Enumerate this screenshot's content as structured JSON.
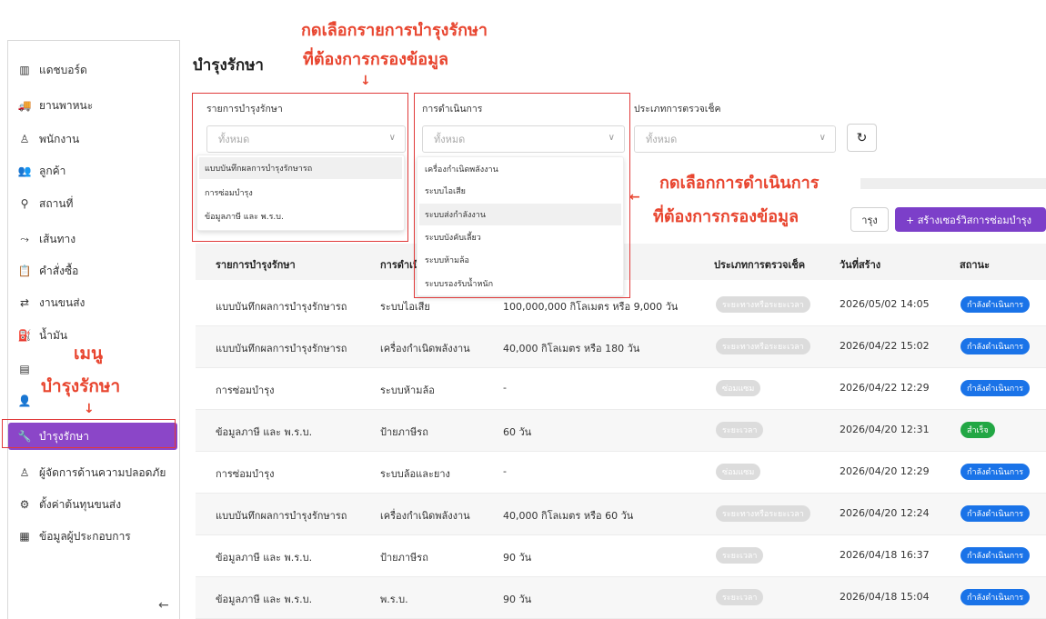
{
  "sidebar": {
    "items": [
      {
        "label": "แดชบอร์ด",
        "icon": "chart-bar-icon",
        "glyph": "▥"
      },
      {
        "label": "ยานพาหนะ",
        "icon": "truck-icon",
        "glyph": "🚚"
      },
      {
        "label": "พนักงาน",
        "icon": "user-icon",
        "glyph": "♙"
      },
      {
        "label": "ลูกค้า",
        "icon": "users-icon",
        "glyph": "👥"
      },
      {
        "label": "สถานที่",
        "icon": "location-pin-icon",
        "glyph": "⚲"
      },
      {
        "label": "เส้นทาง",
        "icon": "route-icon",
        "glyph": "⤳"
      },
      {
        "label": "คำสั่งซื้อ",
        "icon": "clipboard-icon",
        "glyph": "📋"
      },
      {
        "label": "งานขนส่ง",
        "icon": "transport-icon",
        "glyph": "⇄"
      },
      {
        "label": "น้ำมัน",
        "icon": "fuel-icon",
        "glyph": "⛽"
      },
      {
        "label": "",
        "icon": "report-icon",
        "glyph": "▤"
      },
      {
        "label": "",
        "icon": "user-group-icon",
        "glyph": "👤"
      },
      {
        "label": "บำรุงรักษา",
        "icon": "wrench-icon",
        "glyph": "🔧"
      },
      {
        "label": "ผู้จัดการด้านความปลอดภัย",
        "icon": "safety-user-icon",
        "glyph": "♙"
      },
      {
        "label": "ตั้งค่าต้นทุนขนส่ง",
        "icon": "gear-icon",
        "glyph": "⚙"
      },
      {
        "label": "ข้อมูลผู้ประกอบการ",
        "icon": "building-icon",
        "glyph": "▦"
      }
    ],
    "collapse_glyph": "←"
  },
  "page": {
    "title": "บำรุงรักษา"
  },
  "filters": {
    "maintenance_list": {
      "label": "รายการบำรุงรักษา",
      "placeholder": "ทั้งหมด"
    },
    "operation": {
      "label": "การดำเนินการ",
      "placeholder": "ทั้งหมด"
    },
    "inspection_type": {
      "label": "ประเภทการตรวจเช็ค",
      "placeholder": "ทั้งหมด"
    },
    "chevron": "∨",
    "refresh_glyph": "↻"
  },
  "dropdown_maintenance": [
    "แบบบันทึกผลการบำรุงรักษารถ",
    "การซ่อมบำรุง",
    "ข้อมูลภาษี และ พ.ร.บ."
  ],
  "dropdown_operation": [
    "เครื่องกำเนิดพลังงาน",
    "ระบบไอเสีย",
    "ระบบส่งกำลังงาน",
    "ระบบบังคับเลี้ยว",
    "ระบบห้ามล้อ",
    "ระบบรองรับน้ำหนัก"
  ],
  "actions": {
    "outline_label": "ารุง",
    "primary_label": "+ สร้างเซอร์วิสการซ่อมบำรุง"
  },
  "table": {
    "headers": {
      "item": "รายการบำรุงรักษา",
      "operation": "การดำเนิ",
      "inspection_type": "ประเภทการตรวจเช็ค",
      "created": "วันที่สร้าง",
      "status": "สถานะ"
    },
    "rows": [
      {
        "item": "แบบบันทึกผลการบำรุงรักษารถ",
        "operation": "ระบบไอเสีย",
        "interval": "100,000,000 กิโลเมตร หรือ 9,000 วัน",
        "type": "ระยะทางหรือระยะเวลา",
        "created": "2026/05/02 14:05",
        "status": "กำลังดำเนินการ",
        "status_kind": "blue"
      },
      {
        "item": "แบบบันทึกผลการบำรุงรักษารถ",
        "operation": "เครื่องกำเนิดพลังงาน",
        "interval": "40,000 กิโลเมตร หรือ 180 วัน",
        "type": "ระยะทางหรือระยะเวลา",
        "created": "2026/04/22 15:02",
        "status": "กำลังดำเนินการ",
        "status_kind": "blue"
      },
      {
        "item": "การซ่อมบำรุง",
        "operation": "ระบบห้ามล้อ",
        "interval": "-",
        "type": "ซ่อมแซม",
        "created": "2026/04/22 12:29",
        "status": "กำลังดำเนินการ",
        "status_kind": "blue"
      },
      {
        "item": "ข้อมูลภาษี และ พ.ร.บ.",
        "operation": "ป้ายภาษีรถ",
        "interval": "60 วัน",
        "type": "ระยะเวลา",
        "created": "2026/04/20 12:31",
        "status": "สำเร็จ",
        "status_kind": "green"
      },
      {
        "item": "การซ่อมบำรุง",
        "operation": "ระบบล้อและยาง",
        "interval": "-",
        "type": "ซ่อมแซม",
        "created": "2026/04/20 12:29",
        "status": "กำลังดำเนินการ",
        "status_kind": "blue"
      },
      {
        "item": "แบบบันทึกผลการบำรุงรักษารถ",
        "operation": "เครื่องกำเนิดพลังงาน",
        "interval": "40,000 กิโลเมตร หรือ 60 วัน",
        "type": "ระยะทางหรือระยะเวลา",
        "created": "2026/04/20 12:24",
        "status": "กำลังดำเนินการ",
        "status_kind": "blue"
      },
      {
        "item": "ข้อมูลภาษี และ พ.ร.บ.",
        "operation": "ป้ายภาษีรถ",
        "interval": "90 วัน",
        "type": "ระยะเวลา",
        "created": "2026/04/18 16:37",
        "status": "กำลังดำเนินการ",
        "status_kind": "blue"
      },
      {
        "item": "ข้อมูลภาษี และ พ.ร.บ.",
        "operation": "พ.ร.บ.",
        "interval": "90 วัน",
        "type": "ระยะเวลา",
        "created": "2026/04/18 15:04",
        "status": "กำลังดำเนินการ",
        "status_kind": "blue"
      }
    ]
  },
  "annotations": {
    "top_line1": "กดเลือกรายการบำรุงรักษา",
    "top_line2": "ที่ต้องการกรองข้อมูล",
    "right_line1": "กดเลือกการดำเนินการ",
    "right_line2": "ที่ต้องการกรองข้อมูล",
    "menu_line1": "เมนู",
    "menu_line2": "บำรุงรักษา",
    "down_arrow": "↓",
    "left_arrow": "←",
    "color": "#e8452f"
  },
  "colors": {
    "accent": "#8b46c8",
    "primary_button": "#7c3fc9",
    "status_blue": "#1a73e8",
    "status_green": "#22a744",
    "status_gray": "#dcdcdc",
    "annotation_red": "#e03a3a"
  }
}
